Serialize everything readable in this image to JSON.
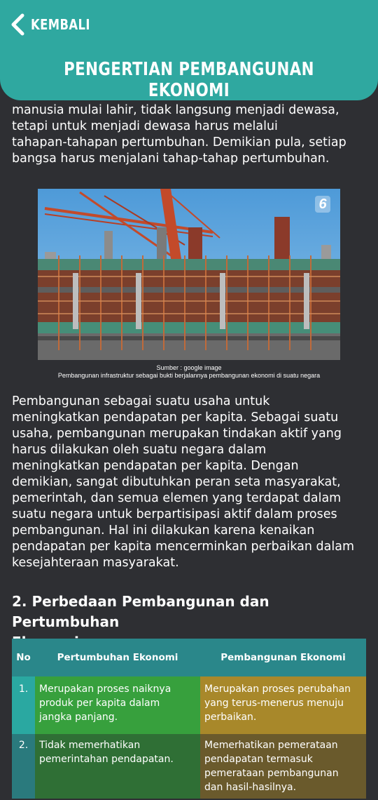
{
  "header": {
    "back_label": "KEMBALI",
    "title": "PENGERTIAN PEMBANGUNAN EKONOMI"
  },
  "content": {
    "intro_lines": [
      "manusia mulai lahir, tidak langsung menjadi dewasa,",
      "tetapi untuk menjadi dewasa harus melalui",
      "tahapan-tahapan pertumbuhan. Demikian pula, setiap",
      "bangsa harus menjalani tahap-tahap pertumbuhan."
    ],
    "image": {
      "watermark": "6",
      "caption_source": "Sumber : google image",
      "caption_text": "Pembangunan infrastruktur sebagai bukti berjalannya pembangunan ekonomi di suatu negara"
    },
    "body_lines": [
      "Pembangunan sebagai suatu usaha untuk",
      "meningkatkan pendapatan per kapita. Sebagai suatu",
      "usaha, pembangunan merupakan tindakan aktif yang",
      "harus dilakukan oleh suatu negara  dalam",
      "meningkatkan pendapatan per kapita. Dengan",
      "demikian, sangat dibutuhkan peran seta masyarakat,",
      "pemerintah, dan semua elemen yang terdapat dalam",
      "suatu negara untuk berpartisipasi aktif dalam proses",
      "pembangunan. Hal ini dilakukan karena kenaikan",
      "pendapatan per kapita mencerminkan perbaikan dalam",
      "kesejahteraan masyarakat."
    ],
    "section_heading_lines": [
      "2. Perbedaan Pembangunan dan Pertumbuhan",
      "Ekonomi"
    ]
  },
  "table": {
    "headers": [
      "No",
      "Pertumbuhan Ekonomi",
      "Pembangunan Ekonomi"
    ],
    "rows": [
      {
        "no": "1.",
        "growth": [
          "Merupakan proses naiknya",
          "produk per kapita dalam",
          "jangka panjang."
        ],
        "development": [
          "Merupakan proses perubahan",
          "yang terus-menerus menuju",
          "perbaikan."
        ]
      },
      {
        "no": "2.",
        "growth": [
          "Tidak memerhatikan",
          "pemerintahan pendapatan."
        ],
        "development": [
          "Memerhatikan pemerataan",
          "pendapatan termasuk",
          "pemerataan pembangunan",
          "dan hasil-hasilnya."
        ]
      }
    ]
  },
  "colors": {
    "header_bg": "#2fa8a0",
    "page_bg": "#2e2f33",
    "table_header_bg": "#2a878a",
    "growth_cell_bg": "#37a03d",
    "development_cell_bg": "#a8882a"
  }
}
